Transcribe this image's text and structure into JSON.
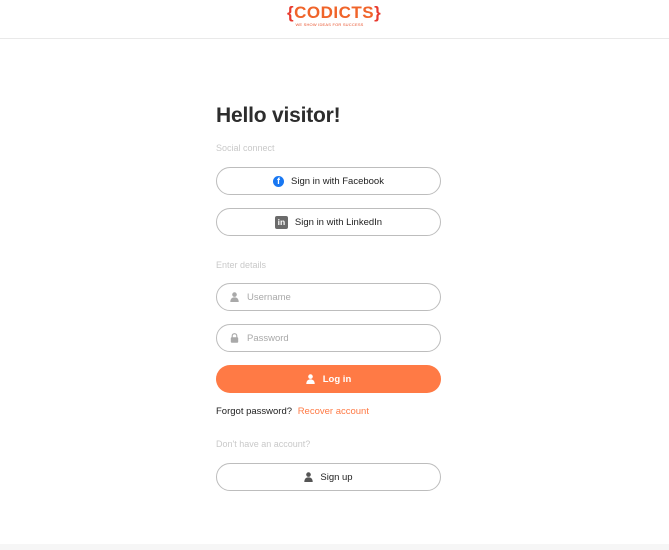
{
  "header": {
    "logo_text": "CODICTS",
    "logo_tagline": "WE SHOW IDEAS FOR SUCCESS"
  },
  "login": {
    "title": "Hello visitor!",
    "social_label": "Social connect",
    "facebook_label": "Sign in with Facebook",
    "linkedin_label": "Sign in with LinkedIn",
    "details_label": "Enter details",
    "username_placeholder": "Username",
    "username_value": "",
    "password_placeholder": "Password",
    "password_value": "",
    "login_label": "Log in",
    "forgot_text": "Forgot password?",
    "recover_label": "Recover account",
    "no_account_label": "Don't have an account?",
    "signup_label": "Sign up"
  },
  "icons": {
    "facebook": "facebook-icon",
    "linkedin": "linkedin-icon",
    "user": "user-icon",
    "lock": "lock-icon"
  },
  "colors": {
    "accent": "#ff7a45",
    "facebook_blue": "#1877f2",
    "muted_label": "#c9c9c9",
    "border": "#bdbdbd"
  }
}
